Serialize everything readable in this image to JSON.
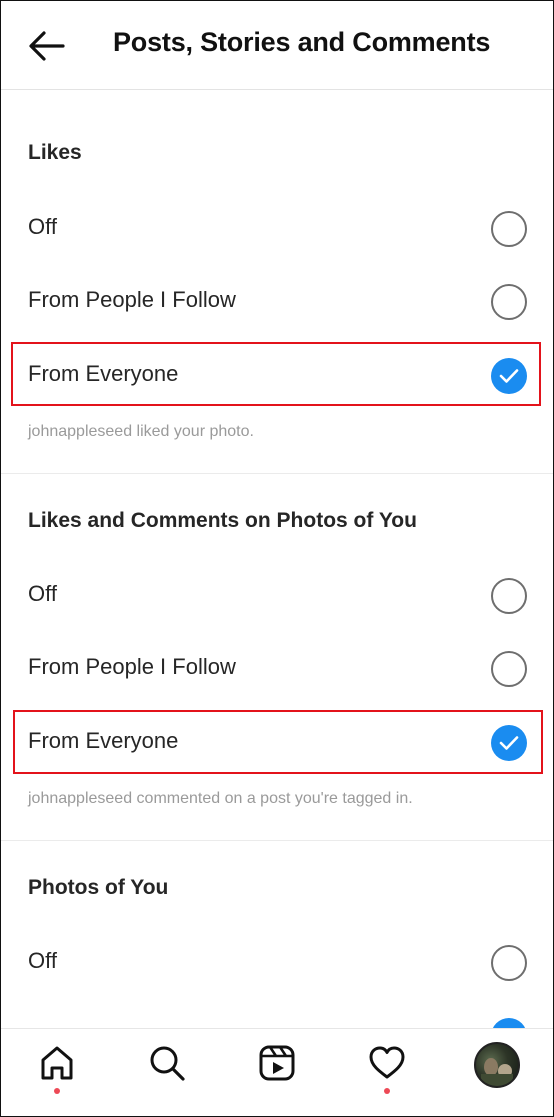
{
  "header": {
    "title": "Posts, Stories and Comments",
    "back_icon": "arrow-left-icon"
  },
  "sections": [
    {
      "title": "Likes",
      "options": [
        {
          "label": "Off",
          "selected": false
        },
        {
          "label": "From People I Follow",
          "selected": false
        },
        {
          "label": "From Everyone",
          "selected": true
        }
      ],
      "caption": "johnappleseed liked your photo."
    },
    {
      "title": "Likes and Comments on Photos of You",
      "options": [
        {
          "label": "Off",
          "selected": false
        },
        {
          "label": "From People I Follow",
          "selected": false
        },
        {
          "label": "From Everyone",
          "selected": true
        }
      ],
      "caption": "johnappleseed commented on a post you're tagged in."
    },
    {
      "title": "Photos of You",
      "options": [
        {
          "label": "Off",
          "selected": false
        }
      ]
    }
  ],
  "colors": {
    "accent": "#1a8cf0",
    "highlight": "#e3131b",
    "notification_dot": "#ed4956"
  },
  "tabbar": {
    "items": [
      "home-icon",
      "search-icon",
      "reels-icon",
      "heart-icon",
      "profile-avatar"
    ]
  }
}
